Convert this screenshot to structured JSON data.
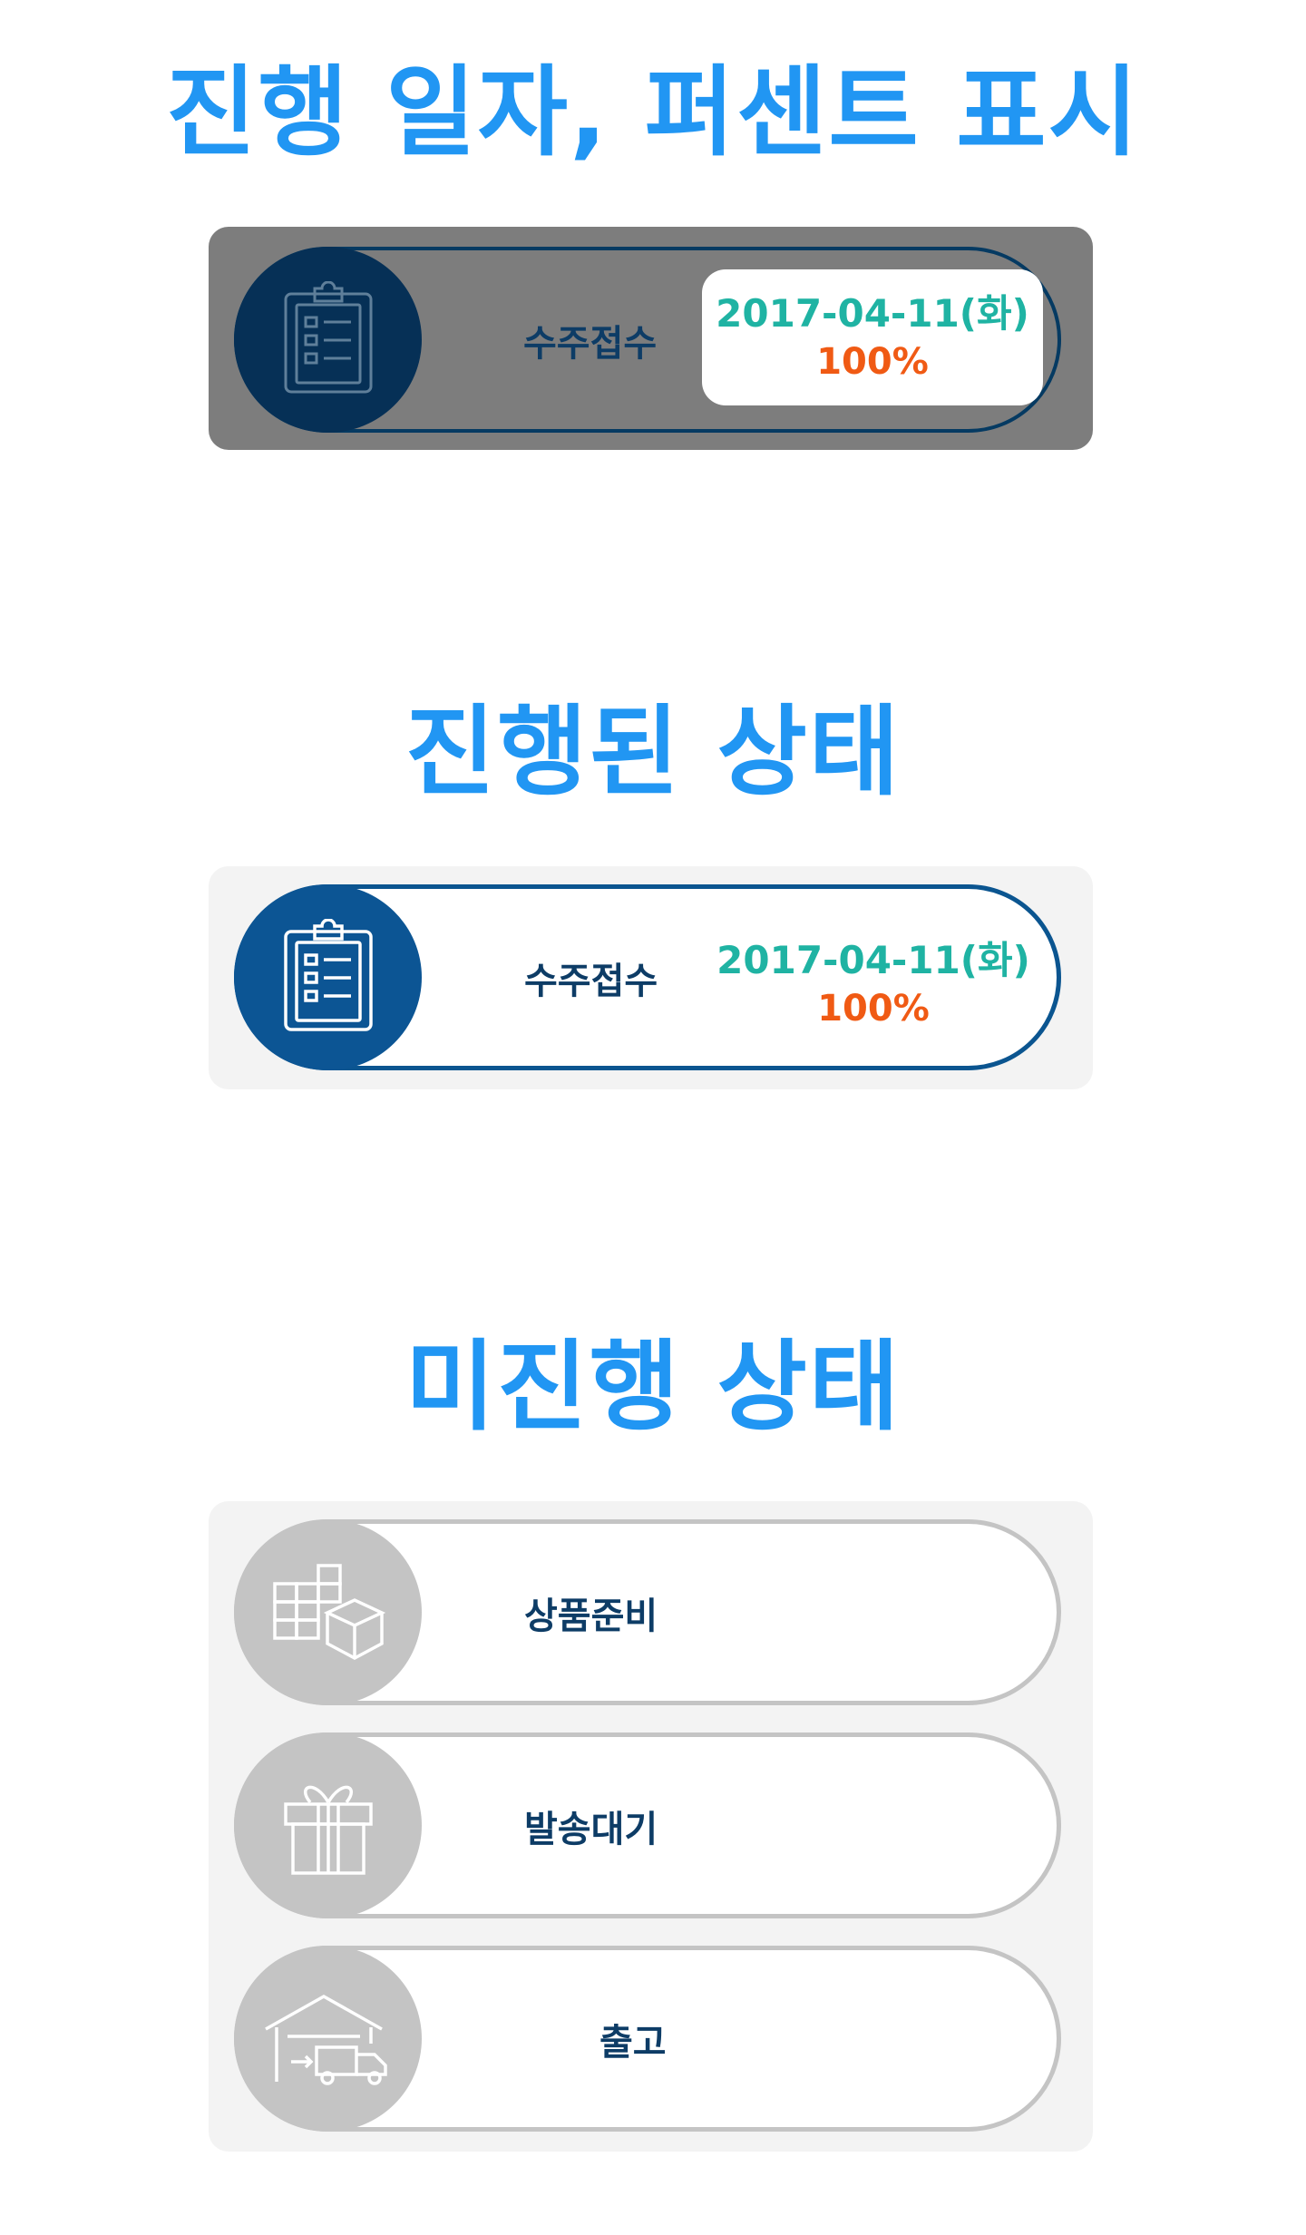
{
  "headings": {
    "with_date": "진행 일자, 퍼센트 표시",
    "done": "진행된 상태",
    "pending": "미진행 상태"
  },
  "hover_state": {
    "stage_label": "수주접수",
    "date": "2017-04-11(화)",
    "percent": "100%",
    "icon": "clipboard-icon"
  },
  "done_state": {
    "stage_label": "수주접수",
    "date": "2017-04-11(화)",
    "percent": "100%",
    "icon": "clipboard-icon"
  },
  "pending_state": {
    "items": [
      {
        "label": "상품준비",
        "icon": "boxes-icon"
      },
      {
        "label": "발송대기",
        "icon": "gift-icon"
      },
      {
        "label": "출고",
        "icon": "warehouse-truck-icon"
      }
    ]
  },
  "colors": {
    "heading": "#2196f3",
    "done_navy": "#0c5594",
    "hover_navy": "#063056",
    "pending_gray": "#c4c4c4",
    "date_teal": "#1fb3a3",
    "percent_orange": "#f05a14",
    "label_navy": "#0d3c66"
  }
}
